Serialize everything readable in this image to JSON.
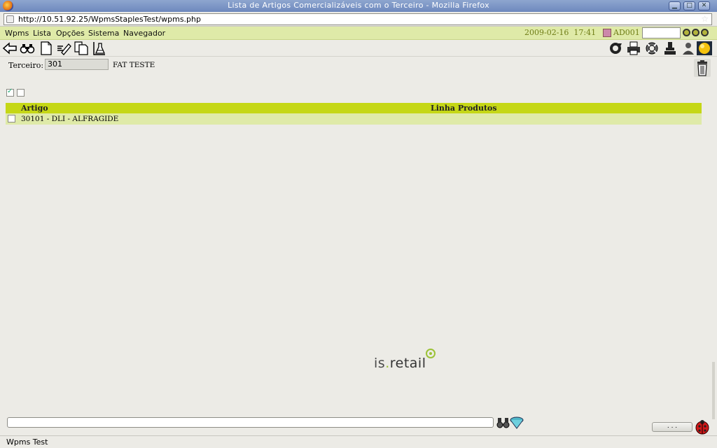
{
  "window": {
    "title": "Lista de Artigos Comercializáveis com o Terceiro - Mozilla Firefox",
    "buttons": {
      "minimize": "▁",
      "maximize": "□",
      "close": "✕"
    }
  },
  "browser": {
    "url": "http://10.51.92.25/WpmsStaplesTest/wpms.php"
  },
  "menu": {
    "items": [
      "Wpms",
      "Lista",
      "Opções",
      "Sistema",
      "Navegador"
    ],
    "date": "2009-02-16",
    "time": "17:41",
    "user": "AD001",
    "user_field_value": ""
  },
  "toolbar": {
    "left_icons": [
      "back-arrow-icon",
      "binoculars-icon",
      "new-document-icon",
      "edit-icon",
      "copy-document-icon",
      "lab-flask-icon"
    ],
    "right_icons": [
      "refresh-icon",
      "print-icon",
      "lifebuoy-icon",
      "hand-stamp-icon",
      "user-icon",
      "yellow-sphere-icon"
    ]
  },
  "form": {
    "terceiro_label": "Terceiro:",
    "terceiro_value": "301",
    "terceiro_name": "FAT TESTE"
  },
  "selection": {
    "select_all_checked": true,
    "deselect_all_checked": false
  },
  "table": {
    "columns": [
      "Artigo",
      "Linha Produtos"
    ],
    "rows": [
      {
        "checked": false,
        "artigo": "30101 - DLI - ALFRAGIDE",
        "linha_produtos": ""
      }
    ]
  },
  "logo": {
    "text_is": "is",
    "text_dot": ".",
    "text_retail": "retail"
  },
  "footer": {
    "search_value": "",
    "ellipsis_label": ". . ."
  },
  "statusbar": {
    "text": "Wpms Test"
  }
}
